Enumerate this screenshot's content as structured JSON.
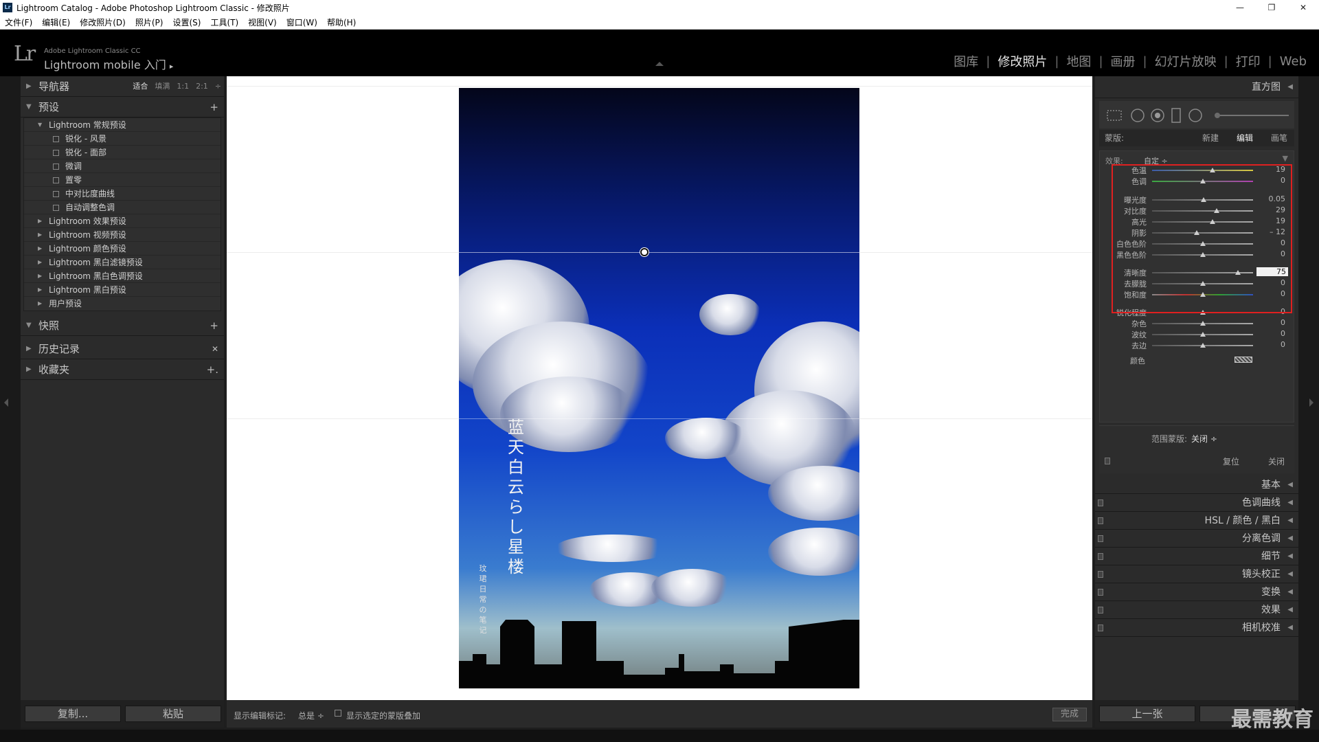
{
  "window": {
    "title": "Lightroom Catalog - Adobe Photoshop Lightroom Classic - 修改照片",
    "app_icon": "Lr",
    "minimize": "—",
    "maximize": "❐",
    "close": "✕"
  },
  "menu": [
    "文件(F)",
    "编辑(E)",
    "修改照片(D)",
    "照片(P)",
    "设置(S)",
    "工具(T)",
    "视图(V)",
    "窗口(W)",
    "帮助(H)"
  ],
  "identity": {
    "logo": "Lr",
    "line1": "Adobe Lightroom Classic CC",
    "line2": "Lightroom mobile 入门",
    "arrow": "▸"
  },
  "modules": [
    "图库",
    "修改照片",
    "地图",
    "画册",
    "幻灯片放映",
    "打印",
    "Web"
  ],
  "active_module": "修改照片",
  "left": {
    "navigator": {
      "title": "导航器",
      "options": [
        "适合",
        "填满",
        "1:1",
        "2:1"
      ],
      "active": "适合",
      "stepper": "÷"
    },
    "presets": {
      "title": "预设",
      "add": "+",
      "groups": [
        {
          "name": "Lightroom 常规预设",
          "expanded": true,
          "items": [
            "锐化 - 风景",
            "锐化 - 面部",
            "微调",
            "置零",
            "中对比度曲线",
            "自动调整色调"
          ]
        },
        {
          "name": "Lightroom 效果预设",
          "expanded": false
        },
        {
          "name": "Lightroom 视频预设",
          "expanded": false
        },
        {
          "name": "Lightroom 颜色预设",
          "expanded": false
        },
        {
          "name": "Lightroom 黑白滤镜预设",
          "expanded": false
        },
        {
          "name": "Lightroom 黑白色调预设",
          "expanded": false
        },
        {
          "name": "Lightroom 黑白预设",
          "expanded": false
        },
        {
          "name": "用户预设",
          "expanded": false
        }
      ]
    },
    "snapshots": {
      "title": "快照",
      "action": "+"
    },
    "history": {
      "title": "历史记录",
      "action": "✕"
    },
    "collections": {
      "title": "收藏夹",
      "action": "+."
    },
    "copy_button": "复制...",
    "paste_button": "粘贴"
  },
  "photo": {
    "title_vertical": "蓝天白云らし星楼",
    "subtitle_vertical": "玟珺日常の笔记"
  },
  "toolbar": {
    "show_markers_label": "显示编辑标记:",
    "show_markers_value": "总是 ÷",
    "overlay_label": "显示选定的蒙版叠加",
    "done": "完成"
  },
  "right": {
    "histogram_title": "直方图",
    "mask_label": "蒙版:",
    "mask_new": "新建",
    "mask_edit": "编辑",
    "mask_brush": "画笔",
    "effect_label": "效果:",
    "effect_value": "自定 ÷",
    "sliders": [
      {
        "name": "色温",
        "value": "19",
        "pos": 0.6,
        "grad": "linear-gradient(90deg,#3a5aa8,#d8c840)"
      },
      {
        "name": "色调",
        "value": "0",
        "pos": 0.5,
        "grad": "linear-gradient(90deg,#3aa840,#b040b0)"
      },
      {
        "name": "曝光度",
        "value": "0.05",
        "pos": 0.51,
        "grad": "linear-gradient(90deg,#555,#aaa)"
      },
      {
        "name": "对比度",
        "value": "29",
        "pos": 0.64,
        "grad": "linear-gradient(90deg,#555,#aaa)"
      },
      {
        "name": "高光",
        "value": "19",
        "pos": 0.6,
        "grad": "linear-gradient(90deg,#555,#aaa)"
      },
      {
        "name": "阴影",
        "value": "– 12",
        "pos": 0.44,
        "grad": "linear-gradient(90deg,#555,#aaa)"
      },
      {
        "name": "白色色阶",
        "value": "0",
        "pos": 0.5,
        "grad": "linear-gradient(90deg,#555,#aaa)"
      },
      {
        "name": "黑色色阶",
        "value": "0",
        "pos": 0.5,
        "grad": "linear-gradient(90deg,#555,#aaa)"
      },
      {
        "name": "清晰度",
        "value": "75",
        "pos": 0.85,
        "grad": "linear-gradient(90deg,#555,#aaa)"
      },
      {
        "name": "去朦胧",
        "value": "0",
        "pos": 0.5,
        "grad": "linear-gradient(90deg,#555,#aaa)"
      },
      {
        "name": "饱和度",
        "value": "0",
        "pos": 0.5,
        "grad": "linear-gradient(90deg,#888,#c23030,#30a030,#3050c0)"
      },
      {
        "name": "锐化程度",
        "value": "0",
        "pos": 0.5,
        "grad": "linear-gradient(90deg,#555,#aaa)"
      },
      {
        "name": "杂色",
        "value": "0",
        "pos": 0.5,
        "grad": "linear-gradient(90deg,#555,#aaa)"
      },
      {
        "name": "波纹",
        "value": "0",
        "pos": 0.5,
        "grad": "linear-gradient(90deg,#555,#aaa)"
      },
      {
        "name": "去边",
        "value": "0",
        "pos": 0.5,
        "grad": "linear-gradient(90deg,#555,#aaa)"
      }
    ],
    "color_label": "颜色",
    "range_mask_label": "范围蒙版:",
    "range_mask_value": "关闭 ÷",
    "reset": "复位",
    "close": "关闭",
    "panels": [
      "基本",
      "色调曲线",
      "HSL / 颜色 / 黑白",
      "分离色调",
      "细节",
      "镜头校正",
      "变换",
      "效果",
      "相机校准"
    ],
    "prev_button": "上一张"
  },
  "watermark": "最需教育",
  "colors": {
    "highlight_box": "#e02020",
    "panel_bg": "#2b2b2b",
    "canvas": "#ffffff"
  }
}
